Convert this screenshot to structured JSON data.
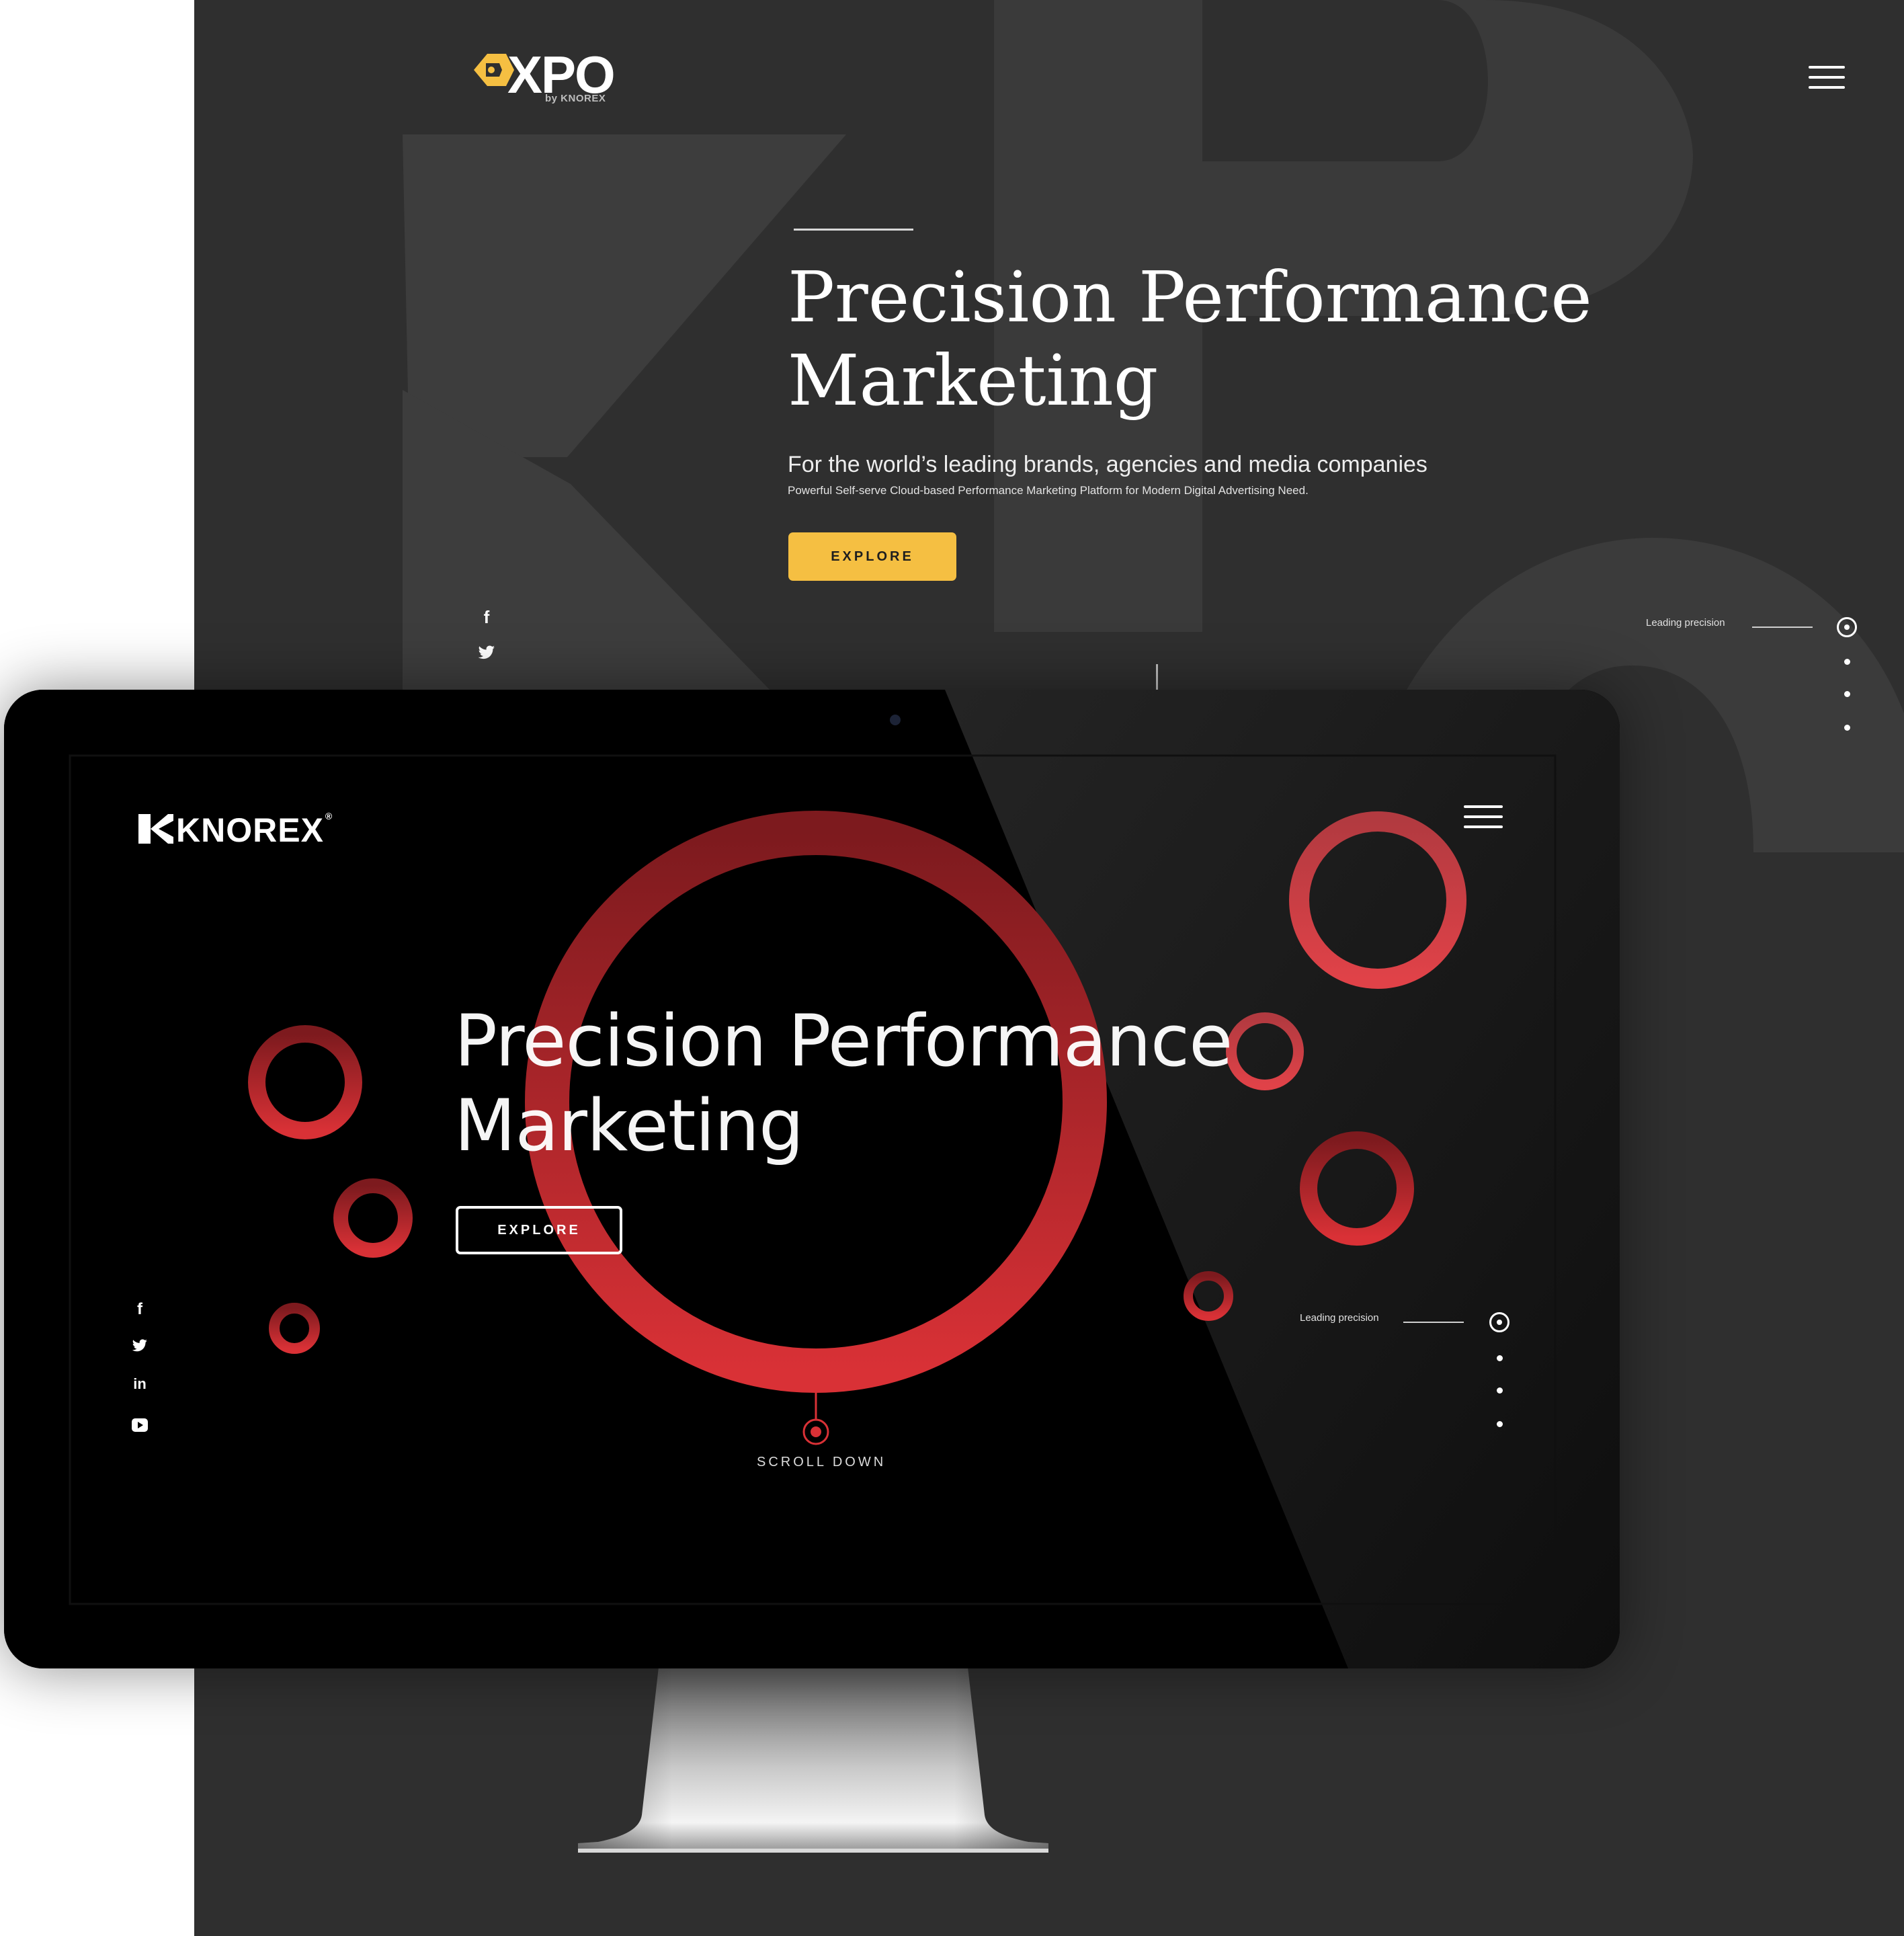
{
  "xpo": {
    "logo_text": "XPO",
    "logo_sub": "by KNOREX",
    "title_line1": "Precision Performance",
    "title_line2": "Marketing",
    "subtitle": "For the world’s leading brands, agencies and media companies",
    "description": "Powerful Self-serve Cloud-based Performance Marketing Platform for Modern Digital Advertising Need.",
    "explore_label": "EXPLORE",
    "leading_label": "Leading precision",
    "social": {
      "facebook": "f",
      "twitter": "🐦"
    },
    "colors": {
      "background": "#2f2f2f",
      "accent": "#f5bf42"
    }
  },
  "knorex": {
    "logo_text": "KNOREX",
    "logo_reg": "®",
    "title_line1": "Precision Performance",
    "title_line2": "Marketing",
    "explore_label": "EXPLORE",
    "scroll_label": "SCROLL DOWN",
    "leading_label": "Leading precision",
    "social": {
      "facebook": "f",
      "twitter": "🐦",
      "linkedin": "in",
      "youtube": "▶"
    },
    "colors": {
      "background": "#000000",
      "accent": "#d93136"
    }
  }
}
